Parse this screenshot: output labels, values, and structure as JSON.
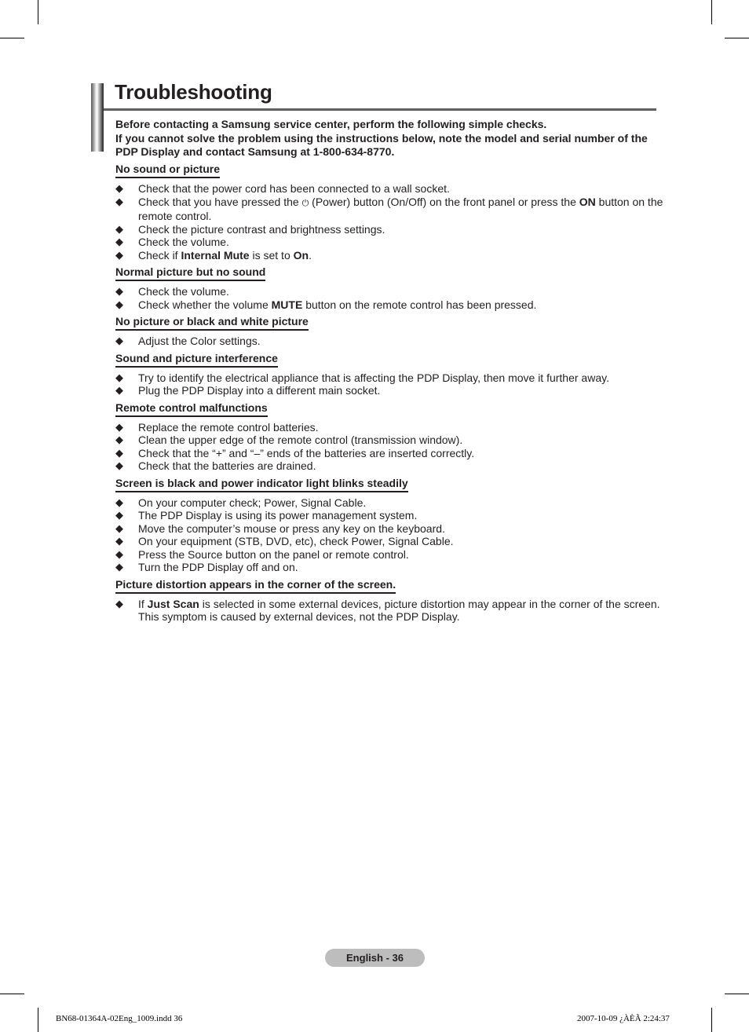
{
  "page": {
    "title": "Troubleshooting",
    "intro": [
      "Before contacting a Samsung service center, perform the following simple checks.",
      "If you cannot solve the problem using the instructions below, note the model and serial number of the PDP Display and contact Samsung at 1-800-634-8770."
    ],
    "sections": [
      {
        "heading": "No sound or picture",
        "items": [
          {
            "parts": [
              {
                "t": "Check that the power cord has been connected to a wall socket."
              }
            ]
          },
          {
            "parts": [
              {
                "t": "Check that you have pressed the "
              },
              {
                "t": "⏻",
                "icon": "power-icon"
              },
              {
                "t": " (Power) button (On/Off) on the front panel or press the "
              },
              {
                "t": "ON",
                "b": true
              },
              {
                "t": " button on the remote control."
              }
            ]
          },
          {
            "parts": [
              {
                "t": "Check the picture contrast and brightness settings."
              }
            ]
          },
          {
            "parts": [
              {
                "t": "Check the volume."
              }
            ]
          },
          {
            "parts": [
              {
                "t": "Check if "
              },
              {
                "t": "Internal Mute",
                "b": true
              },
              {
                "t": " is set to "
              },
              {
                "t": "On",
                "b": true
              },
              {
                "t": "."
              }
            ]
          }
        ]
      },
      {
        "heading": "Normal picture but no sound",
        "items": [
          {
            "parts": [
              {
                "t": "Check the volume."
              }
            ]
          },
          {
            "parts": [
              {
                "t": "Check whether the volume "
              },
              {
                "t": "MUTE",
                "b": true
              },
              {
                "t": " button on the remote control has been pressed."
              }
            ]
          }
        ]
      },
      {
        "heading": "No picture or black and white picture",
        "items": [
          {
            "parts": [
              {
                "t": "Adjust the Color settings."
              }
            ]
          }
        ]
      },
      {
        "heading": "Sound and picture interference",
        "items": [
          {
            "parts": [
              {
                "t": "Try to identify the electrical appliance that is affecting the PDP Display, then move it further away."
              }
            ]
          },
          {
            "parts": [
              {
                "t": "Plug the PDP Display into a different main socket."
              }
            ]
          }
        ]
      },
      {
        "heading": "Remote control malfunctions",
        "items": [
          {
            "parts": [
              {
                "t": "Replace the remote control batteries."
              }
            ]
          },
          {
            "parts": [
              {
                "t": "Clean the upper edge of the remote control (transmission window)."
              }
            ]
          },
          {
            "parts": [
              {
                "t": "Check that the “+” and “–” ends of the batteries are inserted correctly."
              }
            ]
          },
          {
            "parts": [
              {
                "t": "Check that the batteries are drained."
              }
            ]
          }
        ]
      },
      {
        "heading": "Screen is black and power indicator light blinks steadily",
        "items": [
          {
            "parts": [
              {
                "t": "On your computer check; Power, Signal Cable."
              }
            ]
          },
          {
            "parts": [
              {
                "t": "The PDP Display is using its power management system."
              }
            ]
          },
          {
            "parts": [
              {
                "t": "Move the computer’s mouse or press any key on the keyboard."
              }
            ]
          },
          {
            "parts": [
              {
                "t": "On your equipment (STB, DVD, etc), check Power, Signal Cable."
              }
            ]
          },
          {
            "parts": [
              {
                "t": "Press the Source button on the panel or remote control."
              }
            ]
          },
          {
            "parts": [
              {
                "t": "Turn the PDP Display off and on."
              }
            ]
          }
        ]
      },
      {
        "heading": "Picture distortion appears in the corner of the screen.",
        "items": [
          {
            "parts": [
              {
                "t": "If "
              },
              {
                "t": "Just Scan",
                "b": true
              },
              {
                "t": " is selected in some external devices, picture distortion may appear in the corner of the screen. This symptom is caused by external devices, not the PDP Display."
              }
            ]
          }
        ]
      }
    ],
    "bullet_icon": "diamond-bullet-icon",
    "bullet_glyph": "◆",
    "page_label": "English - 36",
    "footer_left": "BN68-01364A-02Eng_1009.indd   36",
    "footer_right": "2007-10-09   ¿ÀÈÃ 2:24:37"
  }
}
